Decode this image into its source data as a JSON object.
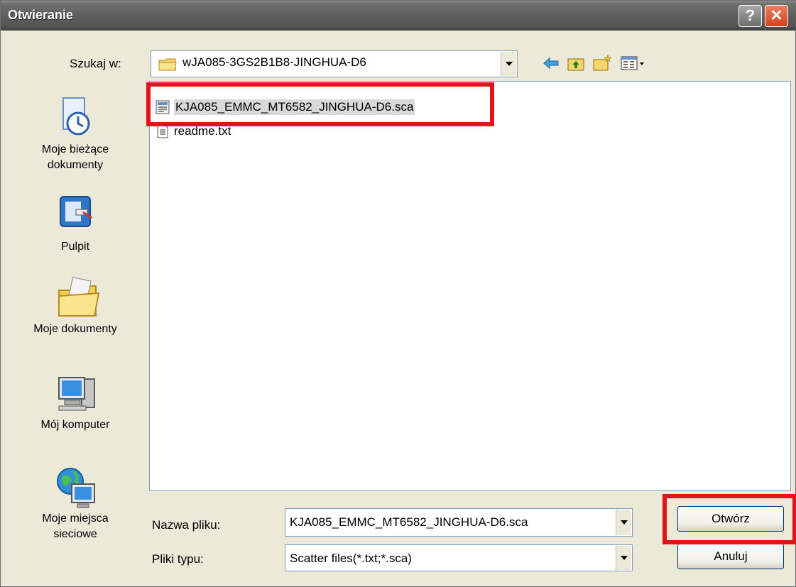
{
  "window": {
    "title": "Otwieranie",
    "help_label": "?",
    "close_label": "✕"
  },
  "lookin": {
    "label": "Szukaj w:",
    "value": "wJA085-3GS2B1B8-JINGHUA-D6"
  },
  "places": [
    {
      "label": "Moje bieżące dokumenty",
      "icon": "recent-documents-icon"
    },
    {
      "label": "Pulpit",
      "icon": "desktop-icon"
    },
    {
      "label": "Moje dokumenty",
      "icon": "my-documents-icon"
    },
    {
      "label": "Mój komputer",
      "icon": "my-computer-icon"
    },
    {
      "label": "Moje miejsca sieciowe",
      "icon": "network-places-icon"
    }
  ],
  "files": [
    {
      "name": "KJA085_EMMC_MT6582_JINGHUA-D6.sca",
      "icon": "scatter-file-icon",
      "selected": true
    },
    {
      "name": "readme.txt",
      "icon": "text-file-icon",
      "selected": false
    }
  ],
  "filename": {
    "label": "Nazwa pliku:",
    "value": "KJA085_EMMC_MT6582_JINGHUA-D6.sca"
  },
  "filetype": {
    "label": "Pliki typu:",
    "value": "Scatter files(*.txt;*.sca)"
  },
  "buttons": {
    "open": "Otwórz",
    "cancel": "Anuluj"
  },
  "colors": {
    "highlight": "#e0141a",
    "title_bar": "#5f5f5f",
    "close_button": "#d24320"
  }
}
